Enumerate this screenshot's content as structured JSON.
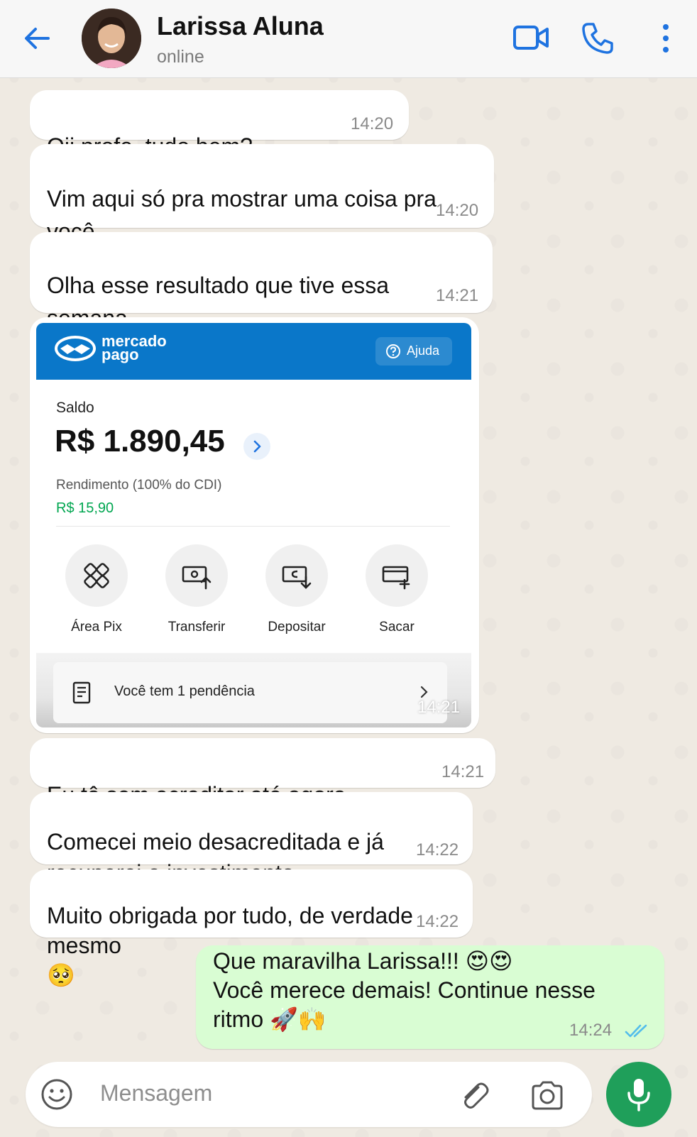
{
  "header": {
    "name": "Larissa Aluna",
    "status": "online",
    "icons": [
      "back-arrow-icon",
      "video-call-icon",
      "phone-icon",
      "more-vertical-icon"
    ]
  },
  "messages": [
    {
      "id": "m1",
      "direction": "in",
      "text": "Oii profe, tudo bem?",
      "emoji": "😊",
      "time": "14:20"
    },
    {
      "id": "m2",
      "direction": "in",
      "text": "Vim aqui só pra mostrar uma coisa pra\nvocê",
      "emoji": "🥺",
      "time": "14:20"
    },
    {
      "id": "m3",
      "direction": "in",
      "text": "Olha esse resultado que tive essa\nsemana",
      "emoji": "😭🙏",
      "time": "14:21"
    },
    {
      "id": "m5",
      "direction": "in",
      "text": "Eu tô sem acreditar até agora",
      "emoji": "😭❤️",
      "time": "14:21"
    },
    {
      "id": "m6",
      "direction": "in",
      "text": "Comecei meio desacreditada e já\nrecuperei o investimento",
      "emoji": "🙏",
      "time": "14:22"
    },
    {
      "id": "m7",
      "direction": "in",
      "text": "Muito obrigada por tudo, de verdade\nmesmo",
      "emoji": "🥺",
      "time": "14:22"
    },
    {
      "id": "m8",
      "direction": "out",
      "text_line1": "Que maravilha Larissa!!!",
      "emoji1": "😍😍",
      "text_line2": "Você merece demais! Continue nesse",
      "text_line3": "ritmo",
      "emoji3": "🚀🙌",
      "time": "14:24",
      "status": "read"
    }
  ],
  "image_message": {
    "time": "14:21",
    "app": {
      "logo_text": "mercado\npago",
      "help_label": "Ajuda",
      "balance_label": "Saldo",
      "balance_value": "R$ 1.890,45",
      "yield_label": "Rendimento (100% do CDI)",
      "yield_value": "R$ 15,90",
      "actions": [
        {
          "label": "Área Pix",
          "icon": "pix-icon"
        },
        {
          "label": "Transferir",
          "icon": "transfer-icon"
        },
        {
          "label": "Depositar",
          "icon": "deposit-icon"
        },
        {
          "label": "Sacar",
          "icon": "withdraw-icon"
        }
      ],
      "pending_text": "Você tem 1 pendência",
      "colors": {
        "brand": "#0a77c9",
        "green": "#00a650"
      }
    }
  },
  "input": {
    "placeholder": "Mensagem"
  },
  "colors": {
    "accent": "#1f73e0",
    "incoming_bubble": "#ffffff",
    "outgoing_bubble": "#d9fdd3",
    "mic_button": "#1f9f5a",
    "read_ticks": "#53bdeb"
  }
}
